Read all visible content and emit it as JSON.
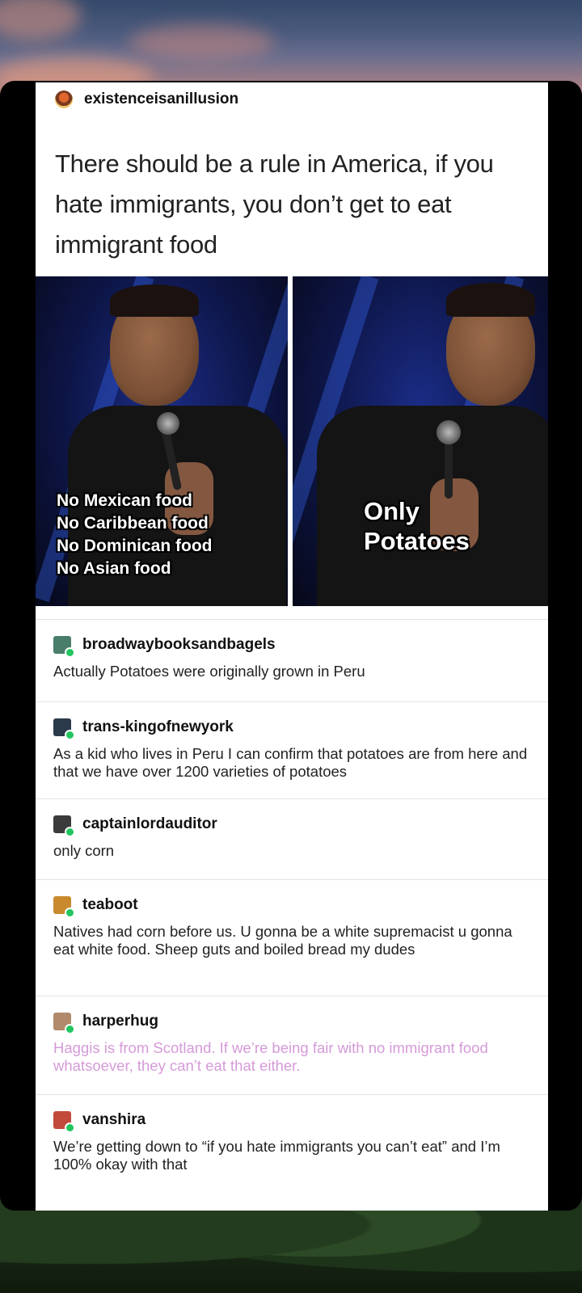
{
  "op": {
    "username": "existenceisanillusion",
    "text": "There should be a rule in America, if you hate immigrants, you don’t get to eat immigrant food"
  },
  "image": {
    "caption_left": [
      "No Mexican food",
      "No Caribbean food",
      "No Dominican food",
      "No Asian food"
    ],
    "caption_right": [
      "Only",
      "Potatoes"
    ]
  },
  "comments": [
    {
      "username": "broadwaybooksandbagels",
      "text": "Actually Potatoes were originally grown in Peru",
      "avatar_color": "#4a7d6a"
    },
    {
      "username": "trans-kingofnewyork",
      "text": "As a kid who lives in Peru I can confirm that potatoes are from here and that we have over 1200 varieties of potatoes",
      "avatar_color": "#2a3a4a"
    },
    {
      "username": "captainlordauditor",
      "text": "only corn",
      "avatar_color": "#3b3b3b"
    },
    {
      "username": "teaboot",
      "text": "Natives had corn before us. U gonna be a white supremacist u gonna eat white food. Sheep guts and boiled bread my dudes",
      "avatar_color": "#c98a2e"
    },
    {
      "username": "harperhug",
      "text": "Haggis is from Scotland. If we’re being fair with no immigrant food whatsoever, they can’t eat that either.",
      "avatar_color": "#b08a6a",
      "text_color": "#d59ad9"
    },
    {
      "username": "vanshira",
      "text": "We’re getting down to “if you hate immigrants you can’t eat” and I’m 100% okay with that",
      "avatar_color": "#c24a3a"
    }
  ]
}
